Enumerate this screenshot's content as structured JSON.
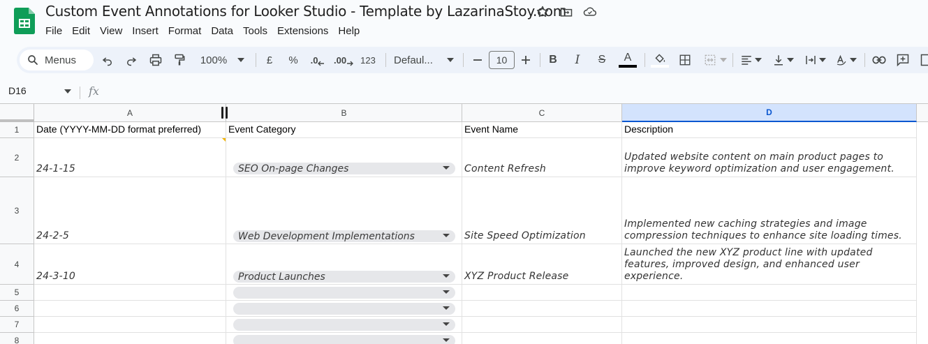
{
  "doc": {
    "title": "Custom Event Annotations for Looker Studio - Template by LazarinaStoy.com"
  },
  "menu": [
    "File",
    "Edit",
    "View",
    "Insert",
    "Format",
    "Data",
    "Tools",
    "Extensions",
    "Help"
  ],
  "toolbar": {
    "search_label": "Menus",
    "zoom": "100%",
    "currency": "£",
    "percent": "%",
    "decrease_decimal": ".0",
    "increase_decimal": ".00",
    "number_format": "123",
    "font": "Defaul...",
    "font_size": "10",
    "bold": "B",
    "italic": "I",
    "strike": "S",
    "text_color_glyph": "A",
    "text_color": "#000000"
  },
  "formula_bar": {
    "cell_ref": "D16",
    "fx": "fx"
  },
  "grid": {
    "columns": [
      "A",
      "B",
      "C",
      "D"
    ],
    "selected_column": "D",
    "row_numbers": [
      "1",
      "2",
      "3",
      "4",
      "5",
      "6",
      "7",
      "8"
    ],
    "header_row": {
      "a": "Date (YYYY-MM-DD format preferred)",
      "b": "Event Category",
      "c": "Event Name",
      "d": "Description"
    },
    "rows": [
      {
        "date": "24-1-15",
        "category": "SEO On-page Changes",
        "name": "Content Refresh",
        "description": "Updated website content on main product pages to improve keyword optimization and user engagement."
      },
      {
        "date": "24-2-5",
        "category": "Web Development Implementations",
        "name": "Site Speed Optimization",
        "description": "Implemented new caching strategies and image compression techniques to enhance site loading times."
      },
      {
        "date": "24-3-10",
        "category": "Product Launches",
        "name": "XYZ Product Release",
        "description": "Launched the new XYZ product line with updated features, improved design, and enhanced user experience."
      }
    ]
  },
  "colors": {
    "sheets_green": "#0f9d58",
    "selected_header": "#d3e3fd",
    "selected_header_text": "#0b57d0",
    "chip": "#e6e7ea",
    "note": "#f4b400"
  }
}
